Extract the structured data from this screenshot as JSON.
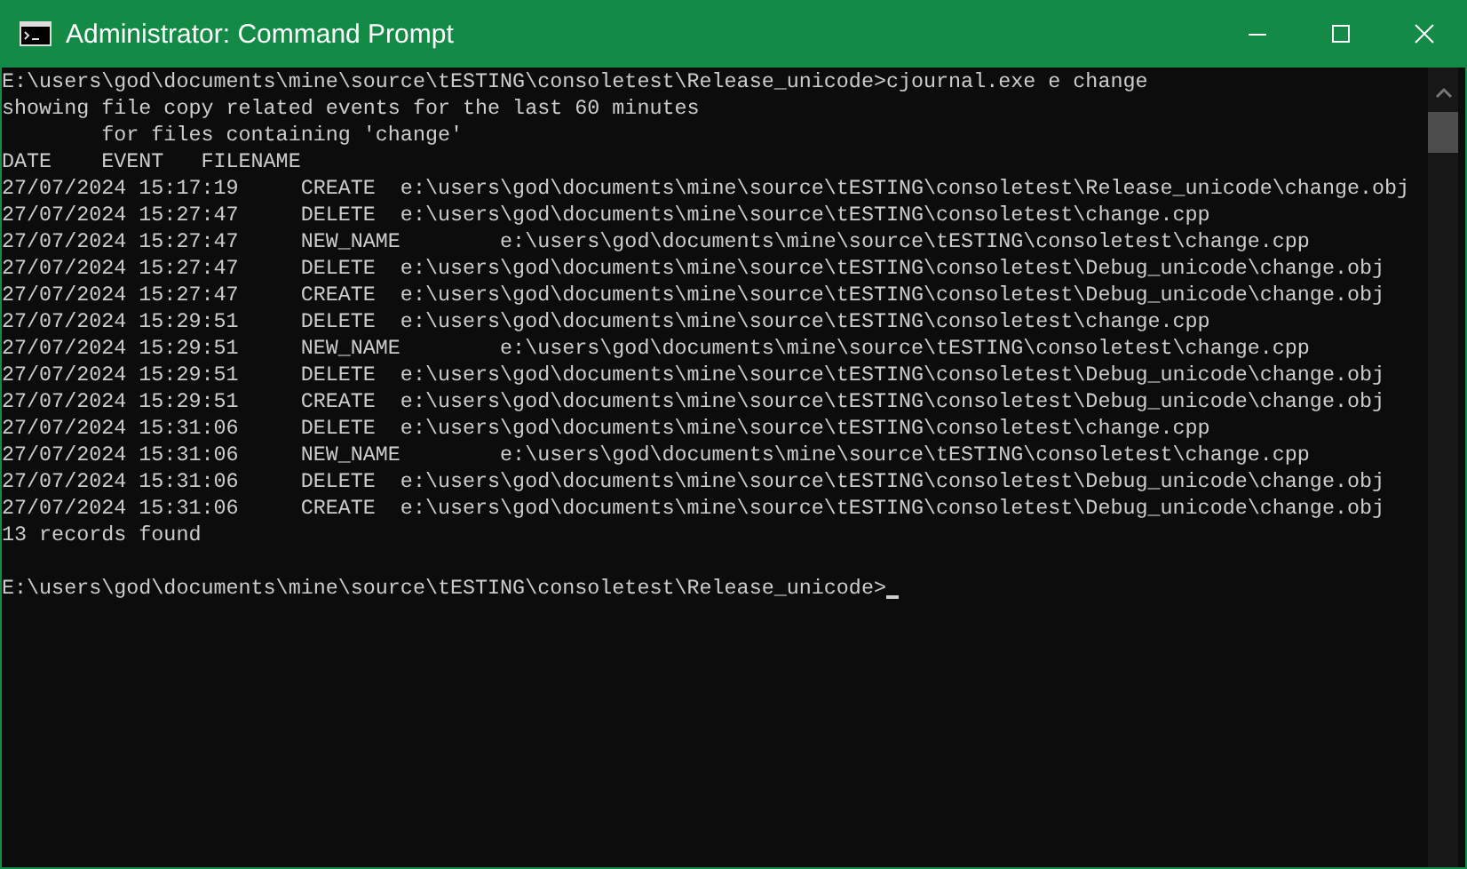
{
  "window": {
    "title": "Administrator: Command Prompt"
  },
  "console": {
    "lines": [
      "E:\\users\\god\\documents\\mine\\source\\tESTING\\consoletest\\Release_unicode>cjournal.exe e change",
      "showing file copy related events for the last 60 minutes",
      "        for files containing 'change'",
      "DATE    EVENT   FILENAME",
      "27/07/2024 15:17:19     CREATE  e:\\users\\god\\documents\\mine\\source\\tESTING\\consoletest\\Release_unicode\\change.obj",
      "27/07/2024 15:27:47     DELETE  e:\\users\\god\\documents\\mine\\source\\tESTING\\consoletest\\change.cpp",
      "27/07/2024 15:27:47     NEW_NAME        e:\\users\\god\\documents\\mine\\source\\tESTING\\consoletest\\change.cpp",
      "27/07/2024 15:27:47     DELETE  e:\\users\\god\\documents\\mine\\source\\tESTING\\consoletest\\Debug_unicode\\change.obj",
      "27/07/2024 15:27:47     CREATE  e:\\users\\god\\documents\\mine\\source\\tESTING\\consoletest\\Debug_unicode\\change.obj",
      "27/07/2024 15:29:51     DELETE  e:\\users\\god\\documents\\mine\\source\\tESTING\\consoletest\\change.cpp",
      "27/07/2024 15:29:51     NEW_NAME        e:\\users\\god\\documents\\mine\\source\\tESTING\\consoletest\\change.cpp",
      "27/07/2024 15:29:51     DELETE  e:\\users\\god\\documents\\mine\\source\\tESTING\\consoletest\\Debug_unicode\\change.obj",
      "27/07/2024 15:29:51     CREATE  e:\\users\\god\\documents\\mine\\source\\tESTING\\consoletest\\Debug_unicode\\change.obj",
      "27/07/2024 15:31:06     DELETE  e:\\users\\god\\documents\\mine\\source\\tESTING\\consoletest\\change.cpp",
      "27/07/2024 15:31:06     NEW_NAME        e:\\users\\god\\documents\\mine\\source\\tESTING\\consoletest\\change.cpp",
      "27/07/2024 15:31:06     DELETE  e:\\users\\god\\documents\\mine\\source\\tESTING\\consoletest\\Debug_unicode\\change.obj",
      "27/07/2024 15:31:06     CREATE  e:\\users\\god\\documents\\mine\\source\\tESTING\\consoletest\\Debug_unicode\\change.obj",
      "13 records found"
    ],
    "prompt": "E:\\users\\god\\documents\\mine\\source\\tESTING\\consoletest\\Release_unicode>"
  }
}
